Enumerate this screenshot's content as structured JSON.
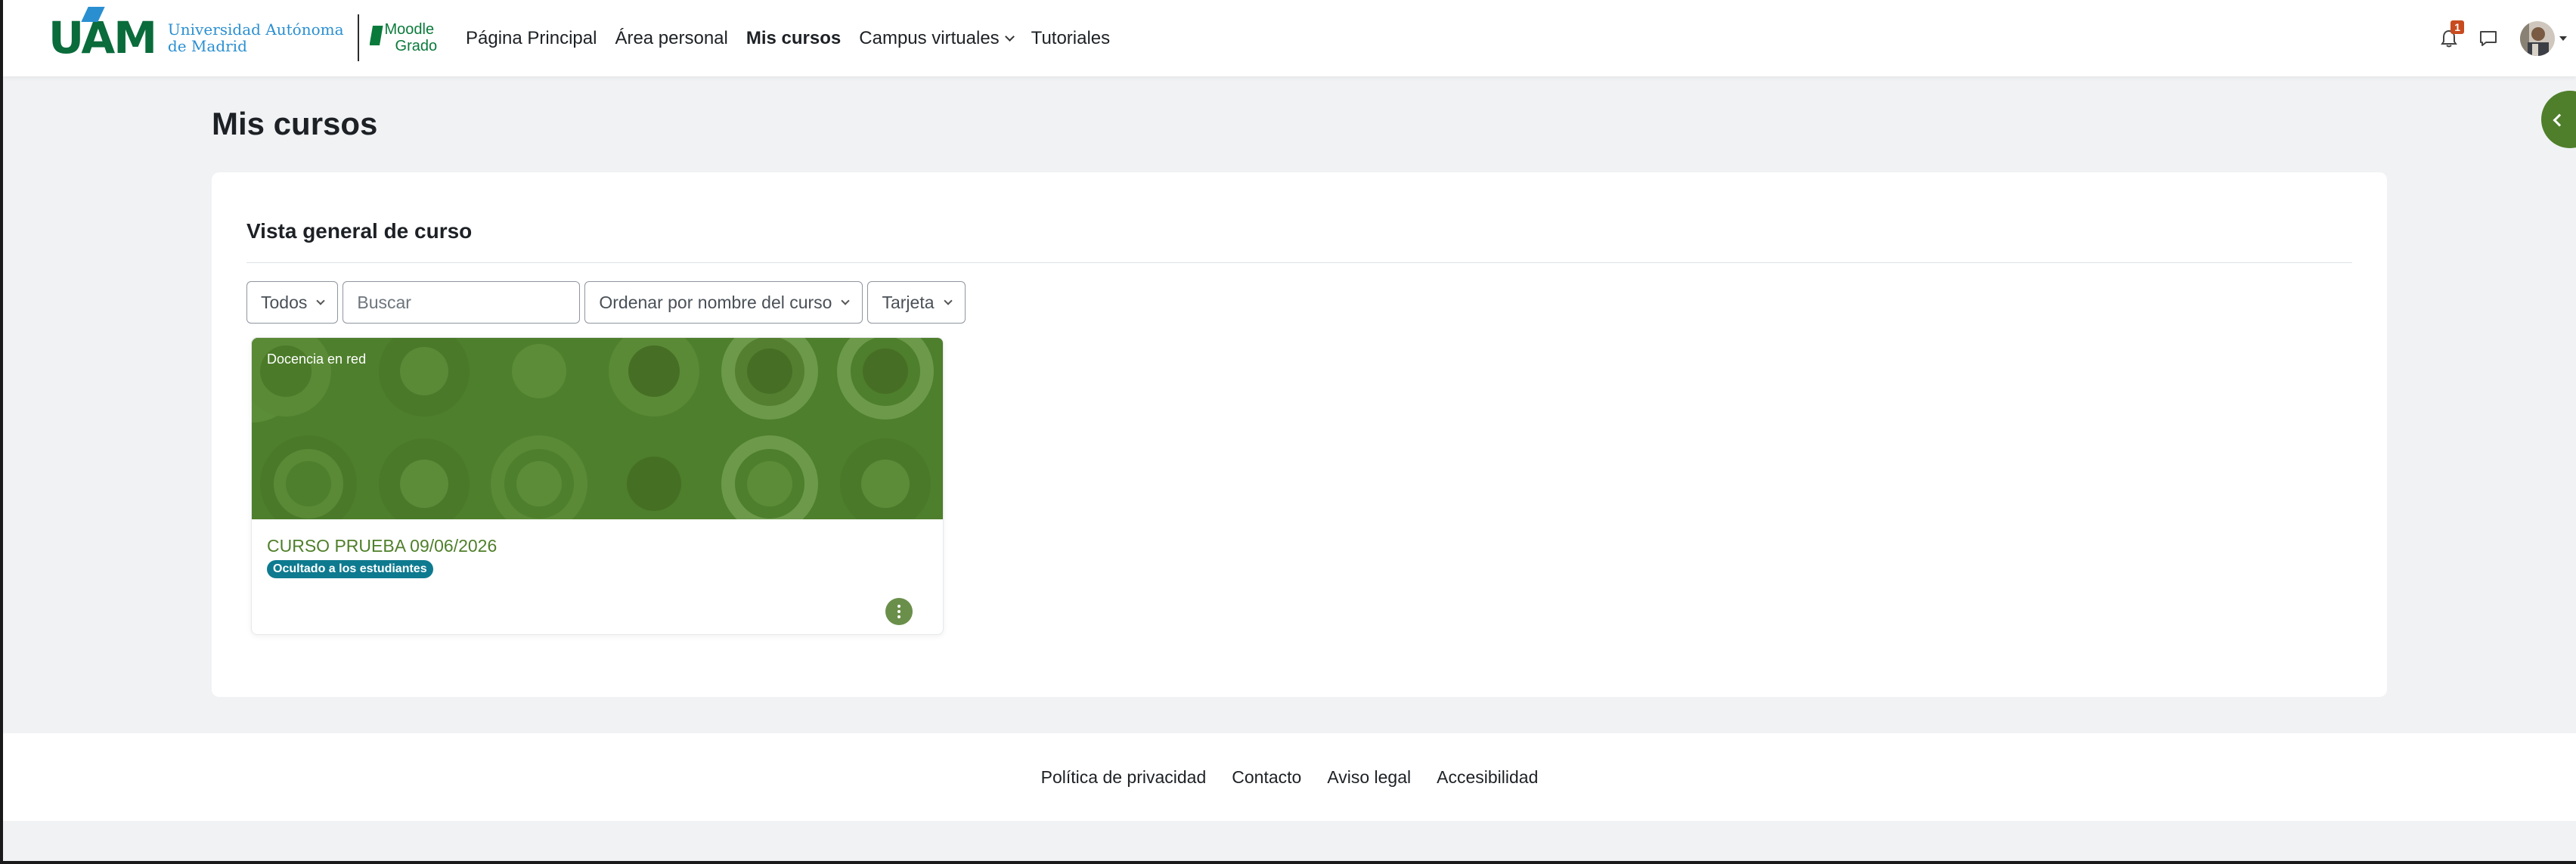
{
  "brand": {
    "uam_logo": "UAM",
    "university_line1": "Universidad Autónoma",
    "university_line2": "de Madrid",
    "moodle_line1": "Moodle",
    "moodle_line2": "Grado"
  },
  "nav": {
    "items": [
      {
        "label": "Página Principal",
        "active": false
      },
      {
        "label": "Área personal",
        "active": false
      },
      {
        "label": "Mis cursos",
        "active": true
      },
      {
        "label": "Campus virtuales",
        "active": false,
        "dropdown": true
      },
      {
        "label": "Tutoriales",
        "active": false
      }
    ]
  },
  "notifications": {
    "count": "1"
  },
  "page": {
    "title": "Mis cursos"
  },
  "overview": {
    "title": "Vista general de curso",
    "filter_label": "Todos",
    "search_placeholder": "Buscar",
    "sort_label": "Ordenar por nombre del curso",
    "view_label": "Tarjeta"
  },
  "courses": [
    {
      "category": "Docencia en red",
      "name": "CURSO PRUEBA 09/06/2026",
      "badge": "Ocultado a los estudiantes"
    }
  ],
  "footer": {
    "links": [
      "Política de privacidad",
      "Contacto",
      "Aviso legal",
      "Accesibilidad"
    ]
  },
  "colors": {
    "accent_green": "#4f7f2a",
    "brand_green": "#0a6b3b",
    "brand_blue": "#2a8fd1",
    "badge_teal": "#0e7a8f",
    "notification_badge": "#c84b1f"
  },
  "icons": [
    "bell-icon",
    "chat-icon",
    "chevron-down-icon",
    "kebab-menu-icon",
    "drawer-toggle-icon"
  ]
}
